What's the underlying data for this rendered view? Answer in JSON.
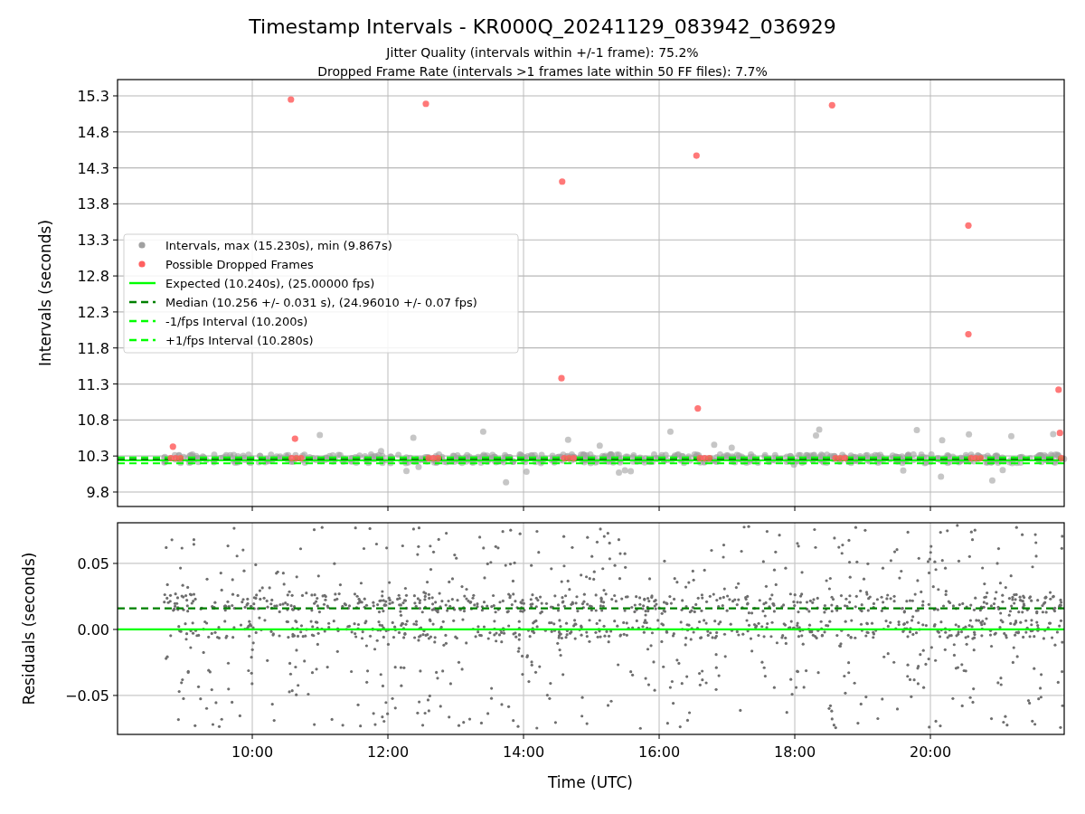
{
  "figure": {
    "title": "Timestamp Intervals - KR000Q_20241129_083942_036929",
    "subtitles": [
      "Jitter Quality (intervals within +/-1 frame): 75.2%",
      "Dropped Frame Rate (intervals >1 frames late within 50 FF files): 7.7%"
    ]
  },
  "top_plot": {
    "intervals_legend": {
      "label": "Intervals, max (15.230s), min (9.867s)",
      "color": "#a0a0a0"
    },
    "chart_data": {
      "type": "scatter",
      "ylabel": "Intervals (seconds)",
      "grid": true,
      "legend": "center left",
      "x": [
        8.8,
        8.83,
        8.87,
        8.94,
        10.57,
        10.58,
        10.63,
        10.65,
        10.72,
        12.56,
        12.6,
        12.67,
        12.74,
        14.56,
        14.57,
        14.6,
        14.67,
        14.74,
        16.55,
        16.57,
        16.6,
        16.67,
        16.74,
        18.55,
        18.6,
        18.67,
        18.74,
        20.56,
        20.56,
        20.6,
        20.67,
        20.74,
        21.89,
        21.91,
        21.93
      ],
      "series": [
        {
          "name": "Possible Dropped Frames",
          "color": "#ff6060",
          "values": [
            10.27,
            10.43,
            10.27,
            10.27,
            15.25,
            10.27,
            10.54,
            10.27,
            10.27,
            15.19,
            10.27,
            10.27,
            10.27,
            11.38,
            14.11,
            10.27,
            10.27,
            10.27,
            14.47,
            10.96,
            10.27,
            10.27,
            10.27,
            15.17,
            10.27,
            10.27,
            10.27,
            13.5,
            11.99,
            10.27,
            10.27,
            10.27,
            11.22,
            10.62,
            10.27
          ]
        }
      ],
      "xlim": [
        8.013,
        21.973
      ],
      "ylim": [
        9.599,
        15.526
      ],
      "yticks": [
        9.8,
        10.3,
        10.8,
        11.3,
        11.8,
        12.3,
        12.8,
        13.3,
        13.8,
        14.3,
        14.8,
        15.3
      ],
      "ref_lines": [
        {
          "axis": "y",
          "value": 10.24,
          "color": "#00ff00",
          "line_style": "solid",
          "label": "Expected (10.240s), (25.00000 fps)"
        },
        {
          "axis": "y",
          "value": 10.256,
          "color": "#008000",
          "line_style": "dashed",
          "label": "Median (10.256 +/- 0.031 s), (24.96010 +/- 0.07 fps)"
        },
        {
          "axis": "y",
          "value": 10.2,
          "color": "#00ff00",
          "line_style": "dashed",
          "label": "-1/fps Interval (10.200s)"
        },
        {
          "axis": "y",
          "value": 10.28,
          "color": "#00ff00",
          "line_style": "dashed",
          "label": "+1/fps Interval (10.280s)"
        }
      ]
    }
  },
  "bottom_plot": {
    "chart_data": {
      "type": "scatter",
      "xlabel": "Time (UTC)",
      "ylabel": "Residuals (seconds)",
      "grid": true,
      "xlim": [
        8.013,
        21.973
      ],
      "ylim": [
        -0.0795,
        0.0808
      ],
      "xticks": [
        {
          "value": 10,
          "label": "10:00"
        },
        {
          "value": 12,
          "label": "12:00"
        },
        {
          "value": 14,
          "label": "14:00"
        },
        {
          "value": 16,
          "label": "16:00"
        },
        {
          "value": 18,
          "label": "18:00"
        },
        {
          "value": 20,
          "label": "20:00"
        }
      ],
      "yticks": [
        {
          "value": -0.05,
          "label": "−0.05"
        },
        {
          "value": 0,
          "label": "0.00"
        },
        {
          "value": 0.05,
          "label": "0.05"
        }
      ],
      "ref_lines": [
        {
          "axis": "y",
          "value": 0,
          "color": "#00ff00",
          "line_style": "solid"
        },
        {
          "axis": "y",
          "value": 0.016,
          "color": "#008000",
          "line_style": "dashed"
        }
      ]
    }
  }
}
